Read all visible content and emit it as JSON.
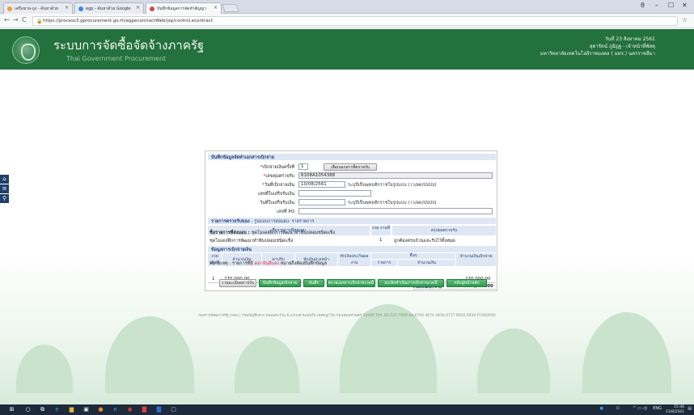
{
  "browser": {
    "tabs": [
      {
        "label": "เครือขาย-ถุง - ค้นหาด้วย",
        "color": "#e9a13a"
      },
      {
        "label": "egp - ค้นหาด้วย Google",
        "color": "#4285f4"
      },
      {
        "label": "บันทึกข้อมูลการจัดทำสัญญา",
        "color": "#d14a4a"
      }
    ],
    "url": "https://process3.gprocurement.go.th/egpecontractWeb/jsp/control.econtract",
    "window_controls": [
      "θ",
      "–",
      "☐",
      "✕"
    ]
  },
  "header": {
    "title": "ระบบการจัดซื้อจัดจ้างภาครัฐ",
    "subtitle": "Thai Government Procurement",
    "date": "วันที่ 23 สิงหาคม 2561",
    "user": "สุดารัตน์ ภูมิฎฐ - เจ้าหน้าที่พัสดุ",
    "org": "มหาวิทยาลัยเทคโนโลยีราชมงคล ( มทร.) นครราชสีมา"
  },
  "sidebar": {
    "icons": [
      "home-icon",
      "menu-icon",
      "search-icon"
    ]
  },
  "form": {
    "section1_title": "บันทึกข้อมูลจัดทำเอกสารเบิกจ่าย",
    "fields": {
      "disbursement_no_label": "เบิกจ่ายเงินครั้งที่",
      "disbursement_no_value": "1",
      "choose_doc_button": "เลือกเอกสารที่ตรวจรับ",
      "contract_no_label": "เลขคุมตรวจรับ",
      "contract_no_value": "6108A1054388",
      "date_label": "วันที่เบิกจ่ายเงิน",
      "date_value": "10/08/2561",
      "date_hint": "ระบุปีเป็นพุทธศักราชในรูปแบบ (วว/ดด/ปปปป)",
      "receipt_no_label": "เลขที่ใบเสร็จรับเงิน",
      "receipt_no_value": "",
      "receipt_date_label": "วันที่ใบเสร็จรับเงิน",
      "receipt_date_value": "",
      "receipt_date_hint": "ระบุปีเป็นพุทธศักราชในรูปแบบ (วว/ดด/ปปปป)",
      "po_label": "เลขที่ PO",
      "po_value": ""
    },
    "section2_title": "รายการตรวจรับของ",
    "section2_sub": ": รูปแบบการส่งมอบ: รายรายการ",
    "items_table": {
      "headers": [
        "ชื่อรายการที่ส่งมอบ",
        "งวด งานที่",
        "สรุปผลตรวจรับ"
      ],
      "row": {
        "name": "ชุดโมเดลฝึกการพัฒนาทำฟันปลอมชนิดแข็ง",
        "installment": "1",
        "result": "ถูกต้องครบถ้วนและรับไว้ทั้งหมด"
      }
    },
    "section3_title": "ข้อมูลการเบิกจ่ายเงิน",
    "pay_table": {
      "headers": [
        "งวด เงินที่",
        "จำนวนเงิน",
        "ค่าปรับ",
        "หักเงินล่วงหน้า",
        "หักเงินประกันผลงาน",
        "อื่นๆ",
        "จำนวนเงินเบิกจ่าย"
      ],
      "sub_headers": [
        "รายการ",
        "จำนวนเงิน"
      ],
      "item_label": "ชื่อรายการที่ส่งมอบ :",
      "item_name": "ชุดโมเดลฝึกการพัฒนาทำฟันปลอมชนิดแข็ง",
      "row": {
        "no": "1",
        "amount": "270,000.00",
        "total": "270,000.00"
      },
      "total_label": "รวมเงินเบิกจ่าย",
      "total_value": "270,000.00"
    },
    "note_prefix": "หมายเหตุ : รายการที่มี",
    "note_highlight": "ดอกจันสีแดง",
    "note_suffix": "หมายถึงต้องบันทึกข้อมูล"
  },
  "actions": [
    {
      "label": "รายละเอียดค่าปรับ",
      "style": "grey"
    },
    {
      "label": "บันทึกข้อมูลเบิกจ่าย",
      "style": "green"
    },
    {
      "label": "บันทึก",
      "style": "green"
    },
    {
      "label": "ตรวจเอกสารเบิกจ่ายงวดนี้",
      "style": "green"
    },
    {
      "label": "ยกเลิกตำเนินการเบิกจ่ายงวดนี้",
      "style": "green"
    },
    {
      "label": "กลับสู่หน้าหลัก",
      "style": "green"
    }
  ],
  "footer": "กองการพัสดุภาครัฐ (กพภ.) กรมบัญชีกลาง ถนนพระราม 6 แขวงสามเสนใน เขตพญาไท กรุงเทพมหานคร 10400 โทร. 02-127-7000 ต่อ 6704 4674 4658 6777 6926 6934 FC000006",
  "taskbar": {
    "lang": "ENG",
    "time": "15:46",
    "date": "23/8/2561"
  }
}
